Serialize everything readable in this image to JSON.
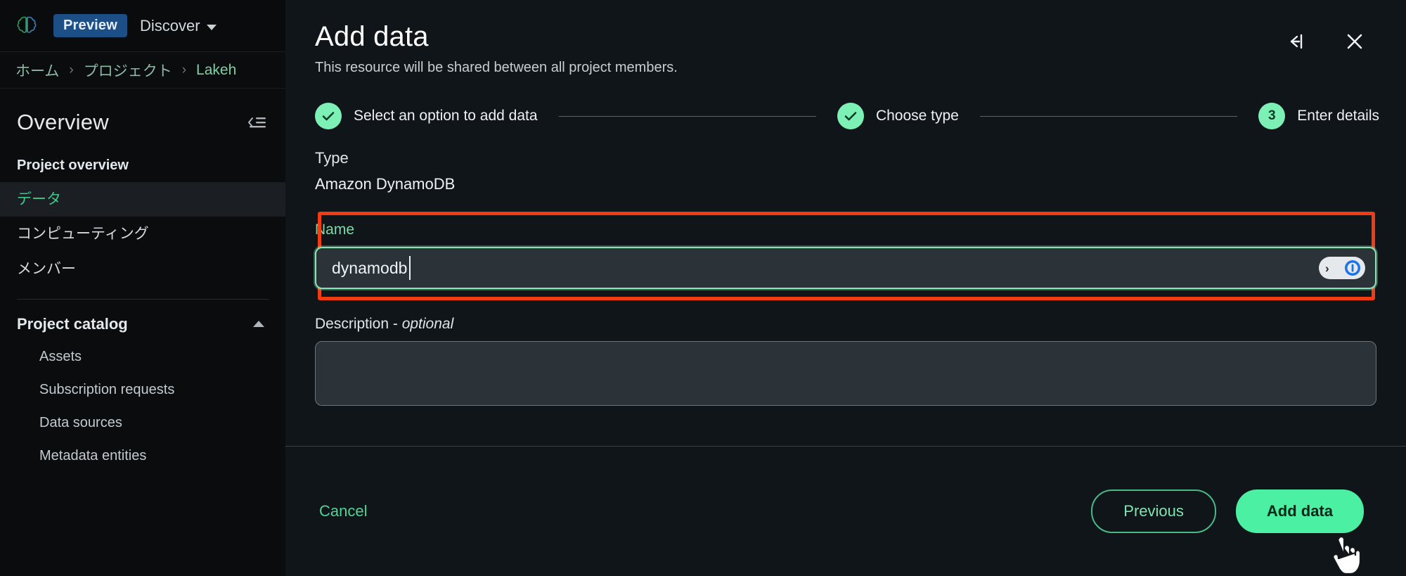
{
  "colors": {
    "accent_green": "#4bf0a2",
    "accent_green_soft": "#7df0b5",
    "annotation_red": "#f23c14",
    "badge_blue": "#1b4f86",
    "modal_bg": "#10151a",
    "shell_bg": "#0a0c0e"
  },
  "topbar": {
    "logo_icon": "brain-logo-icon",
    "preview_badge": "Preview",
    "discover_label": "Discover",
    "discover_icon": "chevron-down-icon"
  },
  "breadcrumb": {
    "items": [
      {
        "label": "ホーム",
        "current": false
      },
      {
        "label": "プロジェクト",
        "current": false
      },
      {
        "label": "Lakeh",
        "current": true
      }
    ],
    "separator": "›"
  },
  "sidebar": {
    "title": "Overview",
    "collapse_icon": "collapse-sidebar-icon",
    "section_label": "Project overview",
    "items": [
      {
        "label": "データ",
        "active": true
      },
      {
        "label": "コンピューティング",
        "active": false
      },
      {
        "label": "メンバー",
        "active": false
      }
    ],
    "catalog": {
      "title": "Project catalog",
      "toggle_icon": "chevron-up-icon",
      "items": [
        {
          "label": "Assets"
        },
        {
          "label": "Subscription requests"
        },
        {
          "label": "Data sources"
        },
        {
          "label": "Metadata entities"
        }
      ]
    }
  },
  "modal": {
    "title": "Add data",
    "subtitle": "This resource will be shared between all project members.",
    "collapse_icon": "collapse-panel-icon",
    "close_icon": "close-icon",
    "stepper": [
      {
        "label": "Select an option to add data",
        "state": "complete",
        "marker": "check-icon"
      },
      {
        "label": "Choose type",
        "state": "complete",
        "marker": "check-icon"
      },
      {
        "label": "Enter details",
        "state": "current",
        "marker": "3"
      }
    ],
    "type": {
      "label": "Type",
      "value": "Amazon DynamoDB"
    },
    "name_field": {
      "label": "Name",
      "value": "dynamodb",
      "placeholder": "",
      "autofill_chevron": "›",
      "autofill_icon": "password-key-icon"
    },
    "description_field": {
      "label_main": "Description - ",
      "label_optional": "optional",
      "value": "",
      "placeholder": ""
    },
    "footer": {
      "cancel_label": "Cancel",
      "previous_label": "Previous",
      "submit_label": "Add data",
      "cursor_icon": "hand-pointer-cursor"
    }
  }
}
